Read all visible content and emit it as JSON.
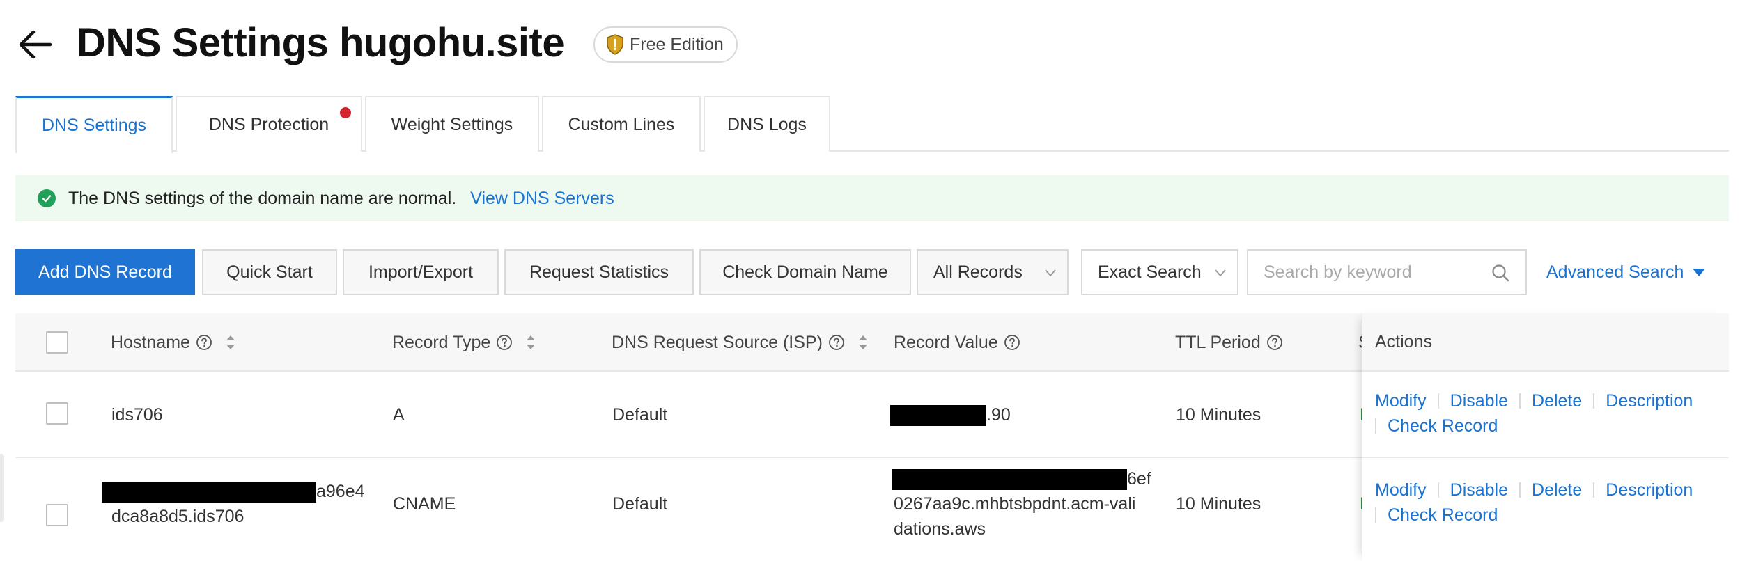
{
  "header": {
    "title": "DNS Settings hugohu.site",
    "edition_badge": "Free Edition"
  },
  "tabs": [
    {
      "label": "DNS Settings",
      "active": true
    },
    {
      "label": "DNS Protection",
      "has_dot": true
    },
    {
      "label": "Weight Settings"
    },
    {
      "label": "Custom Lines"
    },
    {
      "label": "DNS Logs"
    }
  ],
  "notice": {
    "text": "The DNS settings of the domain name are normal.",
    "link": "View DNS Servers"
  },
  "toolbar": {
    "add_record": "Add DNS Record",
    "quick_start": "Quick Start",
    "import_export": "Import/Export",
    "request_statistics": "Request Statistics",
    "check_domain": "Check Domain Name",
    "records_filter": "All Records",
    "search_mode": "Exact Search",
    "search_placeholder": "Search by keyword",
    "advanced_search": "Advanced Search"
  },
  "table": {
    "columns": {
      "hostname": "Hostname",
      "record_type": "Record Type",
      "isp": "DNS Request Source (ISP)",
      "record_value": "Record Value",
      "ttl": "TTL Period",
      "status": "St",
      "actions": "Actions"
    },
    "rows": [
      {
        "hostname_line1": "ids706",
        "record_type": "A",
        "isp": "Default",
        "value_line1_tail": ".90",
        "ttl": "10 Minutes",
        "status": "En"
      },
      {
        "hostname_line1_tail": "a96e4",
        "hostname_line2": "dca8a8d5.ids706",
        "record_type": "CNAME",
        "isp": "Default",
        "value_line1_tail": "6ef",
        "value_line2": "0267aa9c.mhbtsbpdnt.acm-vali",
        "value_line3": "dations.aws",
        "ttl": "10 Minutes",
        "status": "En"
      }
    ],
    "actions": {
      "modify": "Modify",
      "disable": "Disable",
      "delete": "Delete",
      "description": "Description",
      "check_record": "Check Record"
    }
  },
  "colors": {
    "accent": "#1a73d1",
    "primary_button": "#1f73d2",
    "success": "#22a05a",
    "notice_bg": "#eefaf0",
    "alert_dot": "#d1242f"
  }
}
